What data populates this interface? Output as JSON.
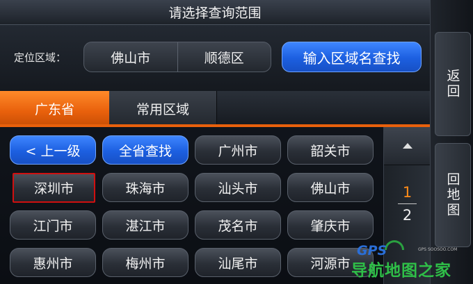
{
  "title": "请选择查询范围",
  "location": {
    "label": "定位区域：",
    "city": "佛山市",
    "district": "顺德区",
    "search_button": "输入区域名查找"
  },
  "tabs": [
    {
      "label": "广东省",
      "active": true
    },
    {
      "label": "常用区域",
      "active": false
    }
  ],
  "grid": {
    "rows": [
      [
        "< 上一级",
        "全省查找",
        "广州市",
        "韶关市"
      ],
      [
        "深圳市",
        "珠海市",
        "汕头市",
        "佛山市"
      ],
      [
        "江门市",
        "湛江市",
        "茂名市",
        "肇庆市"
      ],
      [
        "惠州市",
        "梅州市",
        "汕尾市",
        "河源市"
      ]
    ],
    "selected": "深圳市"
  },
  "pager": {
    "current": "1",
    "total": "2",
    "up_icon": "triangle-up-icon"
  },
  "side": {
    "back": "返回",
    "map": "回地图"
  },
  "watermark": {
    "logo": "GPS",
    "small": "GPS SOOSOO.COM",
    "text": "导航地图之家"
  },
  "colors": {
    "accent_orange": "#e8600c",
    "button_blue": "#1c5fe0",
    "page_current": "#ff8c1a",
    "selected_border": "#d01010"
  }
}
